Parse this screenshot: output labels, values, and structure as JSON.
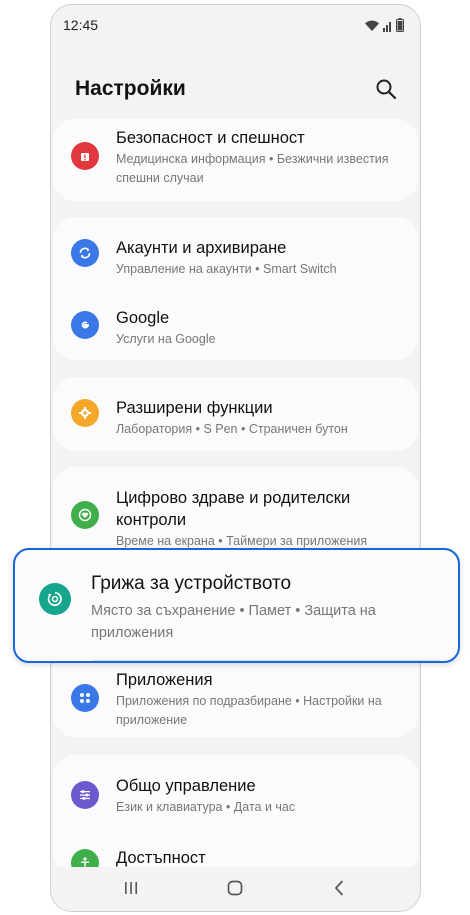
{
  "status_bar": {
    "time": "12:45",
    "icons": [
      "wifi-icon",
      "signal-icon",
      "battery-icon"
    ]
  },
  "header": {
    "title": "Настройки",
    "search_icon": "search-icon"
  },
  "settings": {
    "safety": {
      "title": "Безопасност и спешност",
      "subtitle": "Медицинска информация  •  Безжични известия спешни случаи",
      "icon": "emergency-icon",
      "color": "#e0383e"
    },
    "accounts": {
      "title": "Акаунти и архивиране",
      "subtitle": "Управление на акаунти  •  Smart Switch",
      "icon": "sync-icon",
      "color": "#3b78e7"
    },
    "google": {
      "title": "Google",
      "subtitle": "Услуги на Google",
      "icon": "google-icon",
      "color": "#3b78e7"
    },
    "advanced": {
      "title": "Разширени функции",
      "subtitle": "Лаборатория  •  S Pen  •  Страничен бутон",
      "icon": "gear-plus-icon",
      "color": "#f3a82a"
    },
    "wellbeing": {
      "title": "Цифрово здраве и родителски контроли",
      "subtitle": "Време на екрана  •  Таймери за приложения",
      "icon": "heart-icon",
      "color": "#3fae4b"
    },
    "device_care": {
      "title": "Грижа за устройството",
      "subtitle": "Място за съхранение  •  Памет  •  Защита на приложения",
      "icon": "device-care-icon",
      "color": "#17a58c"
    },
    "apps": {
      "title": "Приложения",
      "subtitle": "Приложения по подразбиране  •  Настройки на приложение",
      "icon": "apps-grid-icon",
      "color": "#3b78e7"
    },
    "general": {
      "title": "Общо управление",
      "subtitle": "Език и клавиатура  •  Дата и час",
      "icon": "sliders-icon",
      "color": "#6a5acd"
    },
    "accessibility": {
      "title": "Достъпност",
      "icon": "accessibility-icon",
      "color": "#3fae4b"
    }
  },
  "nav": {
    "recents": "recents-icon",
    "home": "home-icon",
    "back": "back-icon"
  },
  "colors": {
    "highlight": "#1767d9",
    "background": "#f3f3f6",
    "card": "#fbfbfd"
  }
}
